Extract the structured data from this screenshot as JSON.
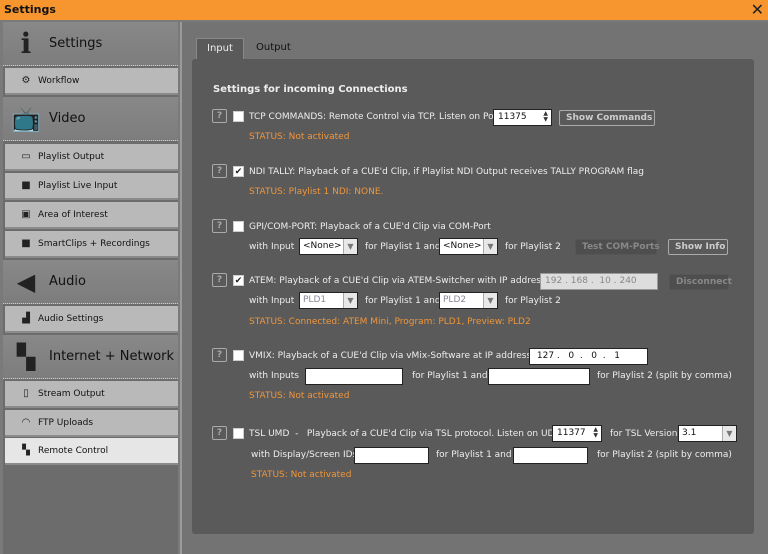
{
  "window": {
    "title": "Settings",
    "close_icon": "close-icon"
  },
  "sidebar": {
    "sections": [
      {
        "label": "Settings"
      },
      {
        "label": "Video"
      },
      {
        "label": "Audio"
      },
      {
        "label": "Internet + Network"
      }
    ],
    "items": [
      {
        "label": "Workflow"
      },
      {
        "label": "Playlist Output"
      },
      {
        "label": "Playlist Live Input"
      },
      {
        "label": "Area of Interest"
      },
      {
        "label": "SmartClips + Recordings"
      },
      {
        "label": "Audio Settings"
      },
      {
        "label": "Stream Output"
      },
      {
        "label": "FTP Uploads"
      },
      {
        "label": "Remote Control",
        "selected": true
      }
    ]
  },
  "tabs": [
    {
      "label": "Input",
      "active": true
    },
    {
      "label": "Output"
    }
  ],
  "heading": "Settings for incoming Connections",
  "help_label": "?",
  "tcp": {
    "checked": false,
    "label": "TCP COMMANDS: Remote Control via TCP. Listen on Port:",
    "port": "11375",
    "button": "Show Commands",
    "status": "STATUS: Not activated"
  },
  "ndi": {
    "checked": true,
    "label": "NDI TALLY: Playback of a CUE'd Clip, if Playlist NDI Output receives TALLY PROGRAM flag",
    "status": "STATUS: Playlist 1 NDI: NONE."
  },
  "gpi": {
    "checked": false,
    "label": "GPI/COM-PORT: Playback of a CUE'd Clip via COM-Port",
    "with_input": "with Input",
    "sel1": "<None>",
    "for_pl1": "for Playlist 1 and",
    "sel2": "<None>",
    "for_pl2": "for Playlist 2",
    "test_button": "Test COM-Ports",
    "info_button": "Show Info"
  },
  "atem": {
    "checked": true,
    "label": "ATEM: Playback of a CUE'd Clip via ATEM-Switcher with IP address:",
    "ip": [
      "192",
      "168",
      "10",
      "240"
    ],
    "button": "Disconnect",
    "with_input": "with Input",
    "sel1": "PLD1",
    "for_pl1": "for Playlist 1 and",
    "sel2": "PLD2",
    "for_pl2": "for Playlist 2",
    "status": "STATUS: Connected: ATEM Mini, Program: PLD1, Preview: PLD2"
  },
  "vmix": {
    "checked": false,
    "label": "VMIX: Playback of a CUE'd Clip via vMix-Software at IP address:",
    "ip": [
      "127",
      "0",
      "0",
      "1"
    ],
    "with_inputs": "with Inputs",
    "input1": "",
    "for_pl1": "for Playlist 1 and",
    "input2": "",
    "for_pl2": "for Playlist 2  (split by comma)",
    "status": "STATUS: Not activated"
  },
  "tsl": {
    "checked": false,
    "label": "TSL UMD  -   Playback of a CUE'd Clip via TSL protocol. Listen on UDP Port",
    "port": "11377",
    "version_label": "for TSL Version",
    "version": "3.1",
    "with_ids": "with Display/Screen IDs",
    "input1": "",
    "for_pl1": "for Playlist 1 and",
    "input2": "",
    "for_pl2": "for Playlist 2  (split by comma)",
    "status": "STATUS: Not activated"
  }
}
